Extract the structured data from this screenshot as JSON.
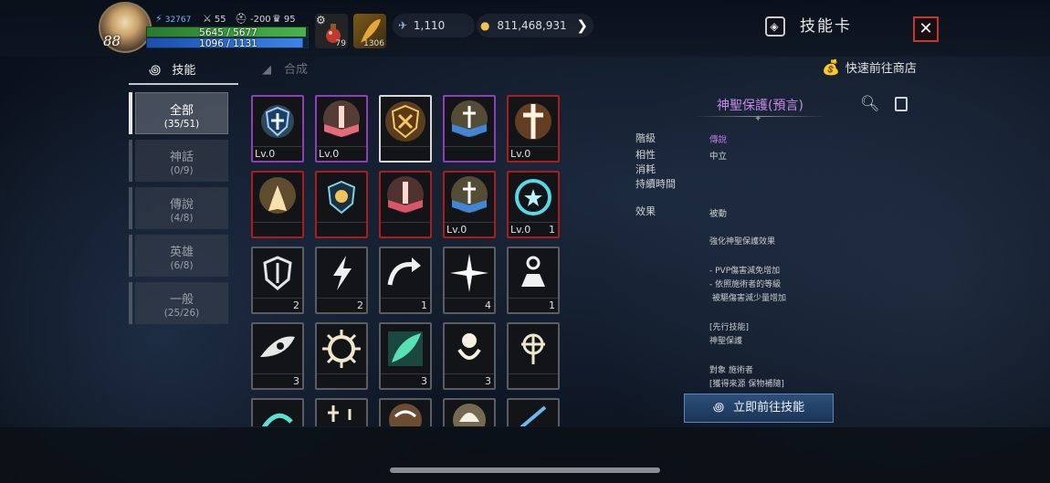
{
  "header": {
    "level": "88",
    "power": "32767",
    "stat_a": "55",
    "stat_b": "-200",
    "stat_c": "95",
    "hp": "5645 / 5677",
    "hp_fraction": 0.99,
    "mp": "1096 / 1131",
    "mp_fraction": 0.97,
    "item1_count": "79",
    "item2_count": "1306",
    "crystals": "1,110",
    "gold": "811,468,931",
    "page_title": "技能卡"
  },
  "tabs": {
    "skill": "技能",
    "synthesis": "合成"
  },
  "shop_link": "快速前往商店",
  "categories": [
    {
      "label": "全部",
      "count": "(35/51)"
    },
    {
      "label": "神話",
      "count": "(0/9)"
    },
    {
      "label": "傳說",
      "count": "(4/8)"
    },
    {
      "label": "英雄",
      "count": "(6/8)"
    },
    {
      "label": "一般",
      "count": "(25/26)"
    }
  ],
  "cards": [
    {
      "lv": "Lv.0",
      "n": ""
    },
    {
      "lv": "Lv.0",
      "n": ""
    },
    {
      "lv": "",
      "n": ""
    },
    {
      "lv": "",
      "n": ""
    },
    {
      "lv": "Lv.0",
      "n": ""
    },
    {
      "lv": "",
      "n": ""
    },
    {
      "lv": "",
      "n": ""
    },
    {
      "lv": "",
      "n": ""
    },
    {
      "lv": "Lv.0",
      "n": ""
    },
    {
      "lv": "Lv.0",
      "n": "1"
    },
    {
      "lv": "",
      "n": "2"
    },
    {
      "lv": "",
      "n": "2"
    },
    {
      "lv": "",
      "n": "1"
    },
    {
      "lv": "",
      "n": "4"
    },
    {
      "lv": "",
      "n": "1"
    },
    {
      "lv": "",
      "n": "3"
    },
    {
      "lv": "",
      "n": ""
    },
    {
      "lv": "",
      "n": "3"
    },
    {
      "lv": "",
      "n": "3"
    },
    {
      "lv": "",
      "n": ""
    }
  ],
  "detail": {
    "title": "神聖保護(預言)",
    "grade_label": "階級",
    "grade_value": "傳說",
    "attr_label": "相性",
    "attr_value": "中立",
    "cost_label": "消耗",
    "duration_label": "持續時間",
    "effect_label": "效果",
    "effect_value": "被動",
    "desc1": "強化神聖保護效果",
    "desc2": "- PVP傷害減免增加",
    "desc3": "- 依照施術者的等級",
    "desc4": "被驅傷害減少量增加",
    "desc5": "[先行技能]",
    "desc6": "神聖保護",
    "desc7": "對象 施術者",
    "desc8": "[獲得來源 保物補隨]",
    "goto_button": "立即前往技能"
  }
}
